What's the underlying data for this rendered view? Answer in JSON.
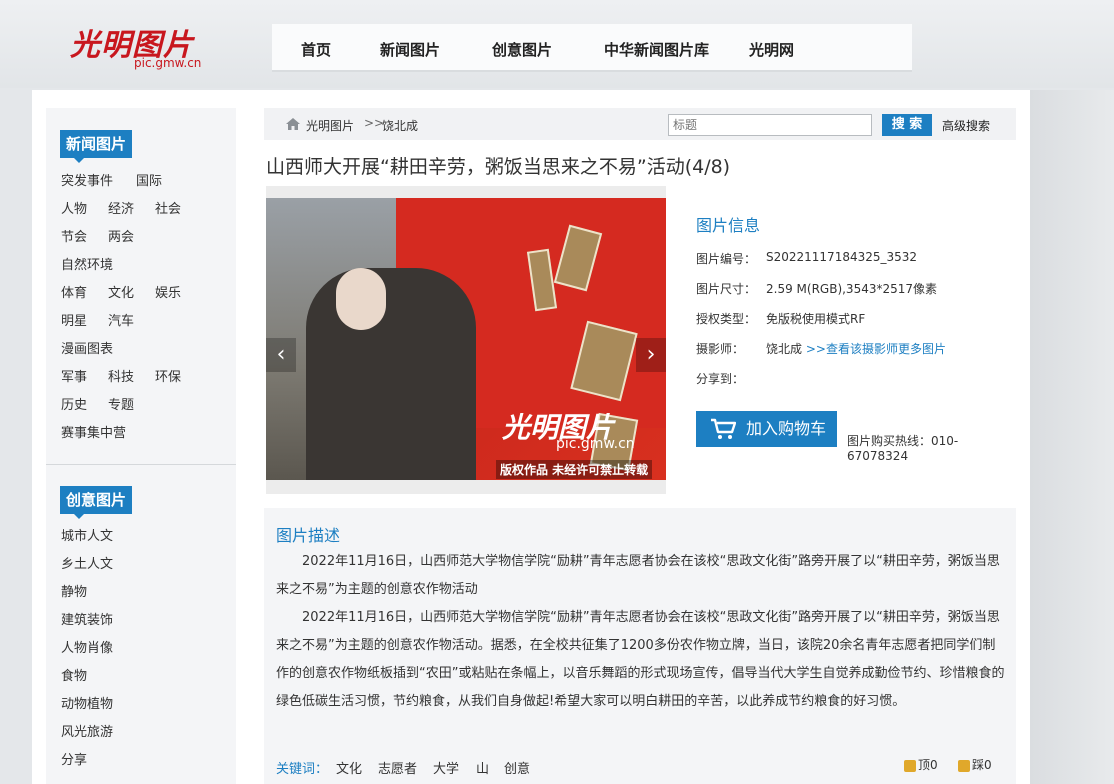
{
  "header": {
    "logo_text": "光明图片",
    "logo_url": "pic.gmw.cn",
    "nav": [
      {
        "label": "首页"
      },
      {
        "label": "新闻图片"
      },
      {
        "label": "创意图片"
      },
      {
        "label": "中华新闻图片库"
      },
      {
        "label": "光明网"
      }
    ]
  },
  "sidebar": {
    "news": {
      "title": "新闻图片",
      "items": [
        "突发事件",
        "国际",
        "人物",
        "经济",
        "社会",
        "节会",
        "两会",
        "自然环境",
        "体育",
        "文化",
        "娱乐",
        "明星",
        "汽车",
        "漫画图表",
        "军事",
        "科技",
        "环保",
        "历史",
        "专题",
        "赛事集中营"
      ]
    },
    "creative": {
      "title": "创意图片",
      "items": [
        "城市人文",
        "乡土人文",
        "静物",
        "建筑装饰",
        "人物肖像",
        "食物",
        "动物植物",
        "风光旅游",
        "分享"
      ]
    }
  },
  "breadcrumb": {
    "home": "光明图片",
    "current": "饶北成"
  },
  "search": {
    "placeholder": "标题",
    "button": "搜 索",
    "advanced": "高级搜索"
  },
  "title": "山西师大开展“耕田辛劳，粥饭当思来之不易”活动(4/8)",
  "photo": {
    "watermark_brand": "光明图片",
    "watermark_url": "pic.gmw.cn",
    "watermark_copyright": "版权作品  未经许可禁止转载"
  },
  "info": {
    "title": "图片信息",
    "id_label": "图片编号：",
    "id_value": "S20221117184325_3532",
    "size_label": "图片尺寸：",
    "size_value": "2.59 M(RGB),3543*2517像素",
    "license_label": "授权类型：",
    "license_value": "免版税使用模式RF",
    "photographer_label": "摄影师：",
    "photographer_value": "饶北成",
    "photographer_link": ">>查看该摄影师更多图片",
    "share_label": "分享到：",
    "cart_button": "加入购物车",
    "hotline": "图片购买热线：010-67078324"
  },
  "description": {
    "title": "图片描述",
    "para1": "2022年11月16日，山西师范大学物信学院“励耕”青年志愿者协会在该校“思政文化街”路旁开展了以“耕田辛劳，粥饭当思来之不易”为主题的创意农作物活动",
    "para2": "2022年11月16日，山西师范大学物信学院“励耕”青年志愿者协会在该校“思政文化街”路旁开展了以“耕田辛劳，粥饭当思来之不易”为主题的创意农作物活动。据悉，在全校共征集了1200多份农作物立牌，当日，该院20余名青年志愿者把同学们制作的创意农作物纸板插到“农田”或粘贴在条幅上，以音乐舞蹈的形式现场宣传，倡导当代大学生自觉养成勤俭节约、珍惜粮食的绿色低碳生活习惯，节约粮食，从我们自身做起!希望大家可以明白耕田的辛苦，以此养成节约粮食的好习惯。",
    "keywords_label": "关键词：",
    "keywords": [
      "文化",
      "志愿者",
      "大学",
      "山",
      "创意"
    ],
    "up_label": "顶0",
    "down_label": "踩0"
  },
  "colors": {
    "accent": "#1d7fc2",
    "brand_red": "#c8171e"
  }
}
